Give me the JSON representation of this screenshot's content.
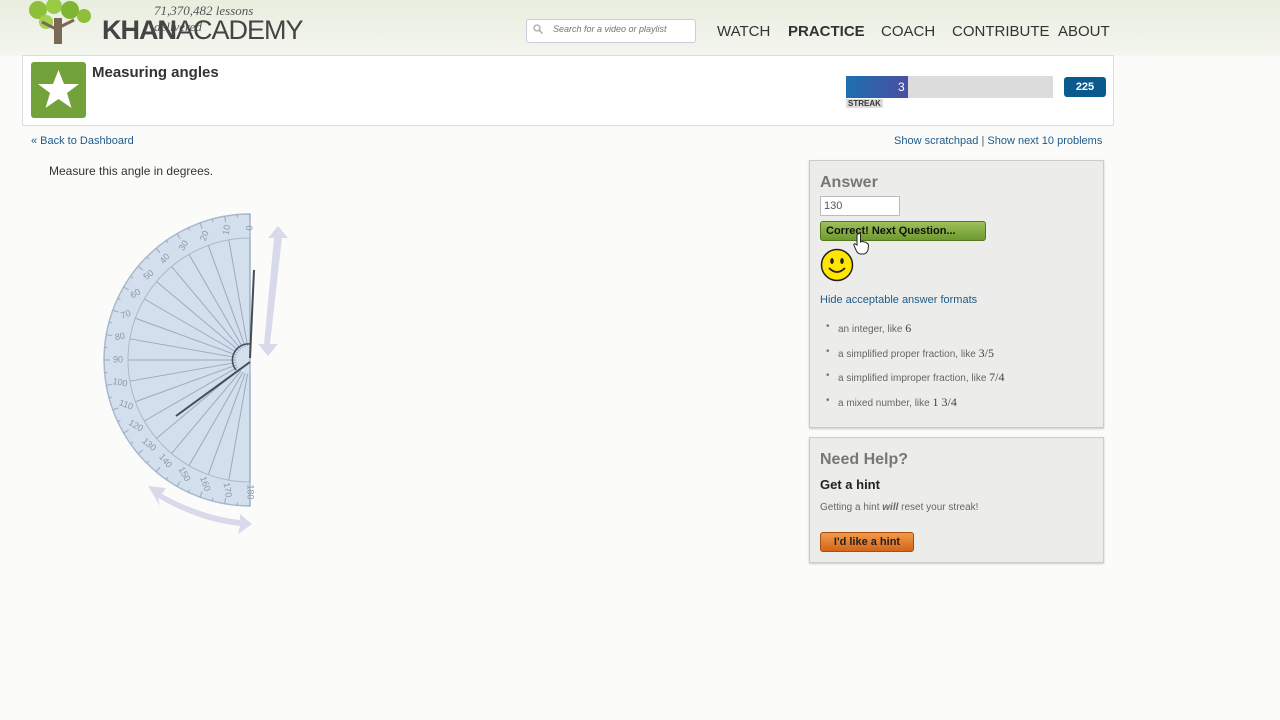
{
  "header": {
    "lessons_delivered": "71,370,482 lessons delivered",
    "logo_khan": "KHAN",
    "logo_academy": "ACADEMY",
    "search": {
      "placeholder": "Search for a video or playlist"
    },
    "nav": [
      {
        "label": "WATCH"
      },
      {
        "label": "PRACTICE",
        "active": true
      },
      {
        "label": "COACH"
      },
      {
        "label": "CONTRIBUTE"
      },
      {
        "label": "ABOUT"
      }
    ]
  },
  "exercise": {
    "title": "Measuring angles",
    "streak": {
      "value": "3",
      "label": "STREAK",
      "fill_fraction": 0.3
    },
    "points": "225",
    "back_link": "« Back to Dashboard",
    "show_scratchpad": "Show scratchpad",
    "separator": "|",
    "show_next": "Show next 10 problems",
    "question": "Measure this angle in degrees.",
    "protractor_ticks": [
      "0",
      "10",
      "20",
      "30",
      "40",
      "50",
      "60",
      "70",
      "80",
      "90",
      "100",
      "110",
      "120",
      "130",
      "140",
      "150",
      "160",
      "170",
      "180"
    ]
  },
  "answer": {
    "heading": "Answer",
    "value": "130",
    "next_button": "Correct! Next Question...",
    "formats_link": "Hide acceptable answer formats",
    "formats": [
      {
        "text": "an integer, like",
        "example": "6"
      },
      {
        "text": "a simplified proper fraction, like",
        "example": "3/5"
      },
      {
        "text": "a simplified improper fraction, like",
        "example": "7/4"
      },
      {
        "text": "a mixed number, like",
        "example": "1 3/4"
      }
    ]
  },
  "help": {
    "heading": "Need Help?",
    "subheading": "Get a hint",
    "warning_pre": "Getting a hint ",
    "warning_em": "will",
    "warning_post": " reset your streak!",
    "hint_button": "I'd like a hint"
  },
  "colors": {
    "brand_green": "#72a33b",
    "link_blue": "#1c5a8c",
    "points_blue": "#0a5a8e",
    "hint_orange": "#e07a2a"
  },
  "icons": [
    "tree-logo-icon",
    "search-icon",
    "star-badge-icon",
    "smiley-icon",
    "hand-cursor-icon"
  ]
}
